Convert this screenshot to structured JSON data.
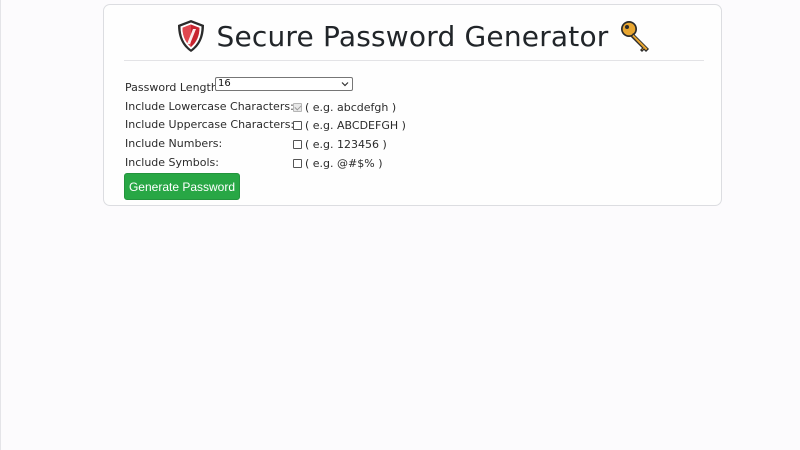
{
  "header": {
    "title": "Secure Password Generator",
    "left_icon": "shield-icon",
    "right_icon": "key-icon"
  },
  "form": {
    "length": {
      "label": "Password Length:",
      "selected": "16"
    },
    "options": [
      {
        "label": "Include Lowercase Characters:",
        "example": "( e.g. abcdefgh )",
        "checked": true,
        "disabled": true
      },
      {
        "label": "Include Uppercase Characters:",
        "example": "( e.g. ABCDEFGH )",
        "checked": false,
        "disabled": false
      },
      {
        "label": "Include Numbers:",
        "example": "( e.g. 123456 )",
        "checked": false,
        "disabled": false
      },
      {
        "label": "Include Symbols:",
        "example": "( e.g. @#$% )",
        "checked": false,
        "disabled": false
      }
    ]
  },
  "actions": {
    "generate_label": "Generate Password"
  },
  "colors": {
    "button": "#28a745",
    "shield_red": "#c8242f",
    "key_gold": "#e8a631"
  }
}
